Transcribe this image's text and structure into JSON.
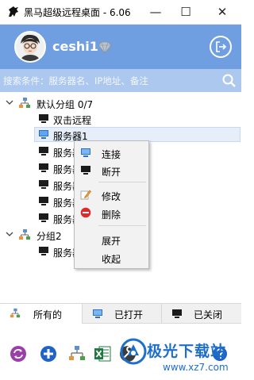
{
  "window": {
    "title": "黑马超级远程桌面 - 6.06",
    "min_glyph": "—",
    "max_glyph": "☐",
    "close_glyph": "✕"
  },
  "header": {
    "username": "ceshi1",
    "accent_color": "#6f9fe0"
  },
  "search": {
    "placeholder": "搜索条件：服务器名、IP地址、备注",
    "value": ""
  },
  "tree": {
    "groups": [
      {
        "label": "默认分组   0/7",
        "expanded": true,
        "servers": [
          "双击远程",
          "服务器1",
          "服务器",
          "服务器",
          "服务器",
          "服务器",
          "服务器"
        ]
      },
      {
        "label": "分组2",
        "expanded": true,
        "servers": [
          "服务器"
        ]
      }
    ],
    "selected": "服务器1"
  },
  "context_menu": {
    "items": [
      {
        "label": "连接",
        "icon": "monitor-icon"
      },
      {
        "label": "断开",
        "icon": "monitor-dark-icon"
      },
      {
        "label": "修改",
        "icon": "edit-icon"
      },
      {
        "label": "删除",
        "icon": "delete-icon"
      },
      {
        "label": "展开",
        "icon": ""
      },
      {
        "label": "收起",
        "icon": ""
      }
    ]
  },
  "tabs": [
    {
      "label": "所有的",
      "icon": "network-icon",
      "active": true
    },
    {
      "label": "已打开",
      "icon": "monitor-icon",
      "active": false
    },
    {
      "label": "已关闭",
      "icon": "monitor-dark-icon",
      "active": false
    }
  ],
  "toolbar": {
    "buttons": [
      "refresh-icon",
      "add-icon",
      "network-icon",
      "excel-icon",
      "settings-icon",
      "help-icon"
    ]
  },
  "watermark": {
    "text": "极光下载站",
    "url": "www.xz7.com"
  }
}
